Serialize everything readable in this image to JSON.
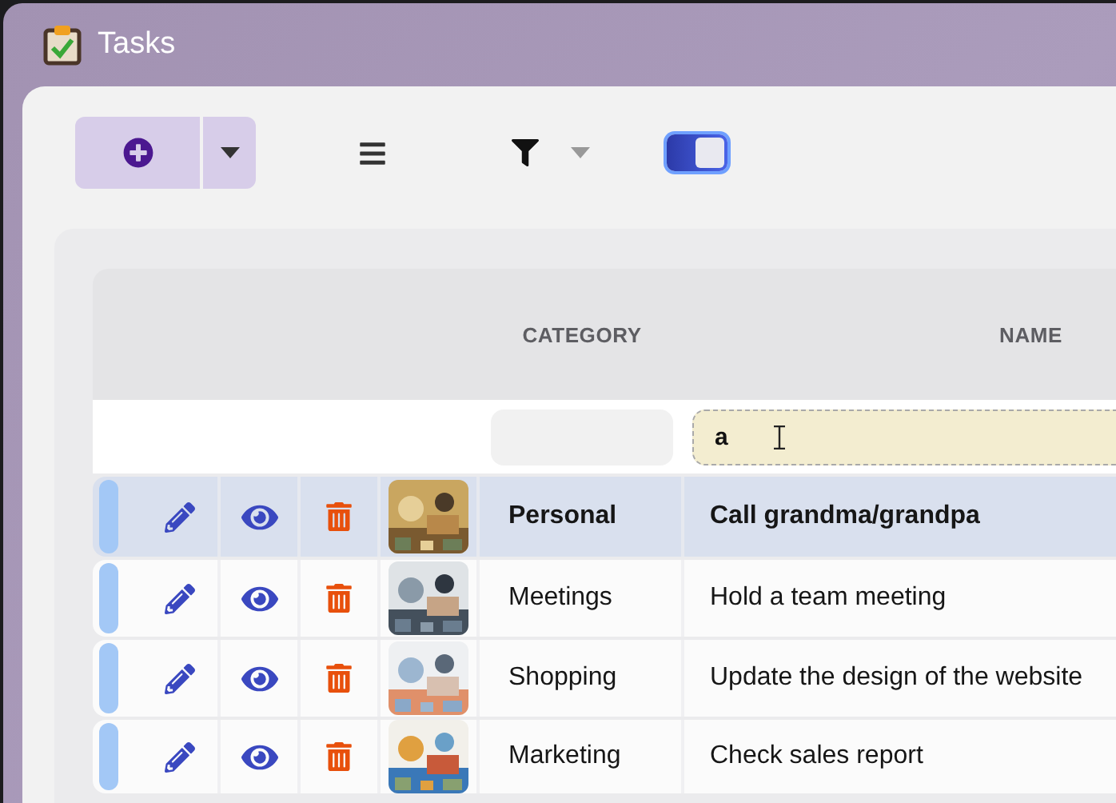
{
  "window": {
    "title": "Tasks"
  },
  "toolbar": {
    "view_toggle": {
      "on": true
    }
  },
  "table": {
    "columns": [
      {
        "label": "CATEGORY"
      },
      {
        "label": "NAME"
      }
    ],
    "name_filter": {
      "value": "a"
    },
    "rows": [
      {
        "category": "Personal",
        "name": "Call grandma/grandpa",
        "selected": true
      },
      {
        "category": "Meetings",
        "name": "Hold a team meeting",
        "selected": false
      },
      {
        "category": "Shopping",
        "name": "Update the design of the website",
        "selected": false
      },
      {
        "category": "Marketing",
        "name": "Check sales report",
        "selected": false
      }
    ]
  }
}
